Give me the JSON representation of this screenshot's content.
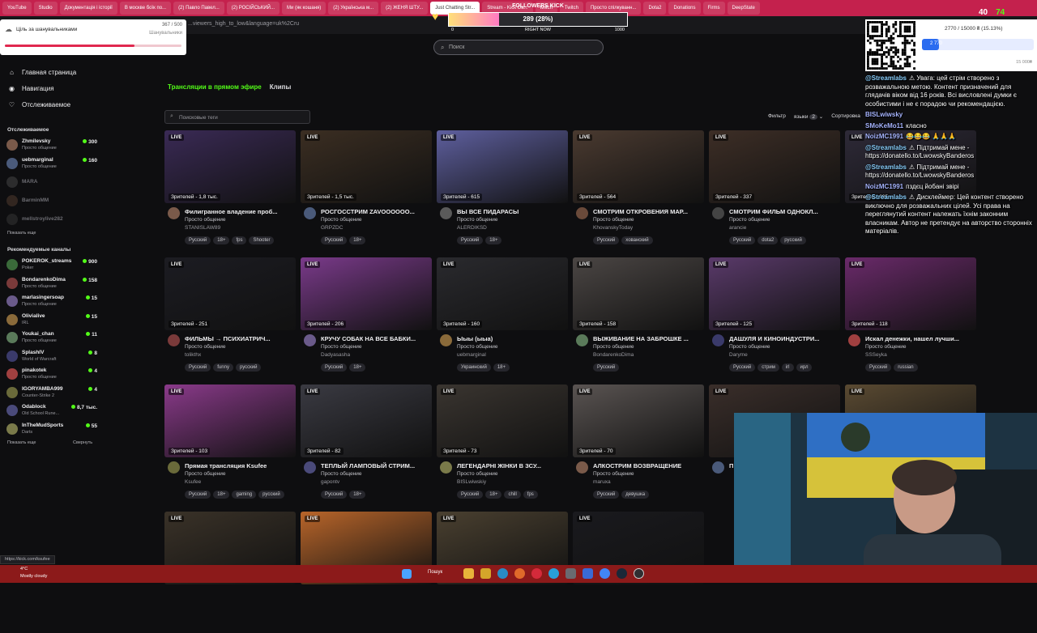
{
  "browser": {
    "tabs": [
      "YouTube",
      "Studio",
      "Документація і історії",
      "В москве боїк по...",
      "(2) Павло Павел...",
      "(2) РОСІЙСЬКИЙ...",
      "Ми (як кошаня)",
      "(2) Українська м...",
      "(2) ЖЕНЯ ШТУ...",
      "Just Chatting Str...",
      "Stream - Kick Da...",
      "twitch",
      "Twitch",
      "Просто спілкуванн...",
      "Dota2",
      "Donations",
      "Firms",
      "DeepState"
    ],
    "active_tab": 9,
    "url": "...viewers_high_to_low&language=uk%2Cru",
    "status_url": "https://kick.com/ksufee"
  },
  "colors": {
    "brand": "#53fc18",
    "tab_bar": "#c4214d",
    "taskbar": "#8c1a1a"
  },
  "overlays": {
    "goal": {
      "icon": "cloud-icon",
      "title": "Ціль за шанувальниками",
      "count": "367 / 500",
      "sub": "Шанувальники",
      "progress": 0.734
    },
    "followers_goal": {
      "label": "FOLLOWERS KICK",
      "value": "289 (28%)",
      "min": "0",
      "mid": "RIGHT NOW",
      "max": "1000",
      "progress": 0.28
    },
    "donate": {
      "text": "2770 / 15000 ₴ (15.13%)",
      "value": "2 770",
      "max": "15 000₴",
      "progress": 0.1513
    },
    "corner": {
      "a": "40",
      "b": "74"
    }
  },
  "header": {
    "search_placeholder": "Поиск"
  },
  "sidebar": {
    "nav": [
      {
        "icon": "home-icon",
        "label": "Главная страница"
      },
      {
        "icon": "compass-icon",
        "label": "Навигация"
      },
      {
        "icon": "heart-icon",
        "label": "Отслеживаемое"
      }
    ],
    "following_title": "Отслеживаемое",
    "following": [
      {
        "name": "Zhmilevsky",
        "category": "Просто общение",
        "viewers": "300",
        "online": true
      },
      {
        "name": "uebmarginal",
        "category": "Просто общение",
        "viewers": "160",
        "online": true
      },
      {
        "name": "MARA",
        "category": "",
        "viewers": "",
        "online": false
      },
      {
        "name": "BarminMM",
        "category": "",
        "viewers": "",
        "online": false
      },
      {
        "name": "mellstroylive282",
        "category": "",
        "viewers": "",
        "online": false
      }
    ],
    "show_more": "Показать еще",
    "recommended_title": "Рекомендуемые каналы",
    "recommended": [
      {
        "name": "POKEROK_streams",
        "category": "Poker",
        "viewers": "900"
      },
      {
        "name": "BondarenkoDima",
        "category": "Просто общение",
        "viewers": "158"
      },
      {
        "name": "marlasingersoap",
        "category": "Просто общение",
        "viewers": "15"
      },
      {
        "name": "Olivialive",
        "category": "IRL",
        "viewers": "15"
      },
      {
        "name": "Youkai_chan",
        "category": "Просто общение",
        "viewers": "11"
      },
      {
        "name": "SplashIV",
        "category": "World of Warcraft",
        "viewers": "8"
      },
      {
        "name": "pinakotek",
        "category": "Просто общение",
        "viewers": "4"
      },
      {
        "name": "IGORYAMBA999",
        "category": "Counter-Strike 2",
        "viewers": "4"
      },
      {
        "name": "Odablock",
        "category": "Old School Rune...",
        "viewers": "8,7 тыс."
      },
      {
        "name": "InTheMudSports",
        "category": "Darts",
        "viewers": "55"
      }
    ],
    "show_more2": "Показать еще",
    "collapse": "Свернуть"
  },
  "main": {
    "tabs": [
      "Трансляции в прямом эфире",
      "Клипы"
    ],
    "tag_placeholder": "Поисковые теги",
    "filter": {
      "label": "Фильтр",
      "languages": "языки",
      "lang_count": "2",
      "sort": "Сортировка"
    },
    "live_label": "LIVE",
    "streams": [
      {
        "viewers": "Зрителей - 1,8 тыс.",
        "title": "Филигранное владение проб...",
        "category": "Просто общение",
        "channel": "STANISLAW89",
        "tags": [
          "Русский",
          "18+",
          "fps",
          "Shooter"
        ],
        "color": "#3a2a55"
      },
      {
        "viewers": "Зрителей - 1,5 тыс.",
        "title": "РОСГОССТРИМ ZAVOOOOOO...",
        "category": "Просто общение",
        "channel": "GRPZDC",
        "tags": [
          "Русский",
          "18+"
        ],
        "color": "#3b2e22"
      },
      {
        "viewers": "Зрителей - 615",
        "title": "ВЫ ВСЕ ПИДАРАСЫ",
        "category": "Просто общение",
        "channel": "ALERDIKSD",
        "tags": [
          "Русский",
          "18+"
        ],
        "color": "#5e5f9e"
      },
      {
        "viewers": "Зрителей - 564",
        "title": "СМОТРИМ ОТКРОВЕНИЯ МАР...",
        "category": "Просто общение",
        "channel": "KhovanskyToday",
        "tags": [
          "Русский",
          "хованский"
        ],
        "color": "#4a3a30"
      },
      {
        "viewers": "Зрителей - 337",
        "title": "СМОТРИМ ФИЛЬМ ОДНОКЛ...",
        "category": "Просто общение",
        "channel": "arancie",
        "tags": [
          "Русский",
          "dota2",
          "русский"
        ],
        "color": "#3d2e26"
      },
      {
        "viewers": "Зрителей - 295",
        "title": "",
        "category": "",
        "channel": "",
        "tags": [],
        "color": "#2e2a38"
      },
      {
        "viewers": "Зрителей - 251",
        "title": "ФИЛЬМЫ → ПСИХИАТРИЧ...",
        "category": "Просто общение",
        "channel": "tolikthx",
        "tags": [
          "Русский",
          "funny",
          "русский"
        ],
        "color": "#1c1c22"
      },
      {
        "viewers": "Зрителей - 206",
        "title": "КРУЧУ СОБАК НА ВСЕ БАБКИ...",
        "category": "Просто общение",
        "channel": "Dadyasasha",
        "tags": [
          "Русский",
          "18+"
        ],
        "color": "#7a3a8a"
      },
      {
        "viewers": "Зрителей - 160",
        "title": "Ыыы (ыыа)",
        "category": "Просто общение",
        "channel": "uebmarginal",
        "tags": [
          "Украинский",
          "18+"
        ],
        "color": "#2a2a2e"
      },
      {
        "viewers": "Зрителей - 158",
        "title": "ВЫЖИВАНИЕ НА ЗАБРОШКЕ ...",
        "category": "Просто общение",
        "channel": "BondarenkoDima",
        "tags": [
          "Русский"
        ],
        "color": "#4b4644"
      },
      {
        "viewers": "Зрителей - 125",
        "title": "ДАШУЛЯ И КИНОИНДУСТРИ...",
        "category": "Просто общение",
        "channel": "Daryme",
        "tags": [
          "Русский",
          "стрим",
          "irl",
          "ирл"
        ],
        "color": "#5a3a6a"
      },
      {
        "viewers": "Зрителей - 118",
        "title": "Искал денежки, нашел лучши...",
        "category": "Просто общение",
        "channel": "SSSeyka",
        "tags": [
          "Русский",
          "russian"
        ],
        "color": "#6a2a6a"
      },
      {
        "viewers": "Зрителей - 103",
        "title": "Прямая трансляция Ksufee",
        "category": "Просто общение",
        "channel": "Ksufee",
        "tags": [
          "Русский",
          "18+",
          "gaming",
          "русский"
        ],
        "color": "#8a3a8a"
      },
      {
        "viewers": "Зрителей - 82",
        "title": "ТЕПЛЫЙ ЛАМПОВЫЙ СТРИМ...",
        "category": "Просто общение",
        "channel": "gapontv",
        "tags": [
          "Русский",
          "18+"
        ],
        "color": "#3a3a42"
      },
      {
        "viewers": "Зрителей - 73",
        "title": "ЛЕГЕНДАРНІ ЖІНКИ В ЗСУ...",
        "category": "Просто общение",
        "channel": "BISLwiwskiy",
        "tags": [
          "Русский",
          "18+",
          "chill",
          "fps"
        ],
        "color": "#3a3530"
      },
      {
        "viewers": "Зрителей - 70",
        "title": "АЛКОСТРИМ ВОЗВРАЩЕНИЕ",
        "category": "Просто общение",
        "channel": "maruxa",
        "tags": [
          "Русский",
          "девушка"
        ],
        "color": "#5a5452"
      },
      {
        "viewers": "",
        "title": "П",
        "category": "",
        "channel": "",
        "tags": [],
        "color": "#3a2e2a"
      },
      {
        "viewers": "",
        "title": "",
        "category": "",
        "channel": "",
        "tags": [],
        "color": "#5a4a32"
      },
      {
        "viewers": "",
        "title": "",
        "category": "",
        "channel": "",
        "tags": [],
        "color": "#3a3228"
      },
      {
        "viewers": "",
        "title": "",
        "category": "",
        "channel": "",
        "tags": [],
        "color": "#b8652a"
      },
      {
        "viewers": "",
        "title": "",
        "category": "",
        "channel": "",
        "tags": [],
        "color": "#4a4030"
      },
      {
        "viewers": "",
        "title": "",
        "category": "",
        "channel": "",
        "tags": [],
        "color": "#1a1a1e"
      }
    ]
  },
  "chat": [
    {
      "user": "@Streamlabs",
      "text": "⚠ Увага: цей стрім створено з розважальною метою. Контент призначений для глядачів віком від 16 років. Всі висловлені думки є особистими і не є порадою чи рекомендацією."
    },
    {
      "user": "BISLwiwsky",
      "text": ""
    },
    {
      "user": "SMoKeMo11",
      "text": "класно"
    },
    {
      "user": "NoizMC1991",
      "text": "😂😂😂 🙏🙏🙏"
    },
    {
      "user": "@Streamlabs",
      "text": "⚠ Підтримай мене - https://donatello.to/LwowskyBanderos"
    },
    {
      "user": "@Streamlabs",
      "text": "⚠ Підтримай мене - https://donatello.to/LwowskyBanderos"
    },
    {
      "user": "NoizMC1991",
      "text": "пздєц йобані звірі"
    },
    {
      "user": "@Streamlabs",
      "text": "⚠ Дисклеймер: Цей контент створено виключно для розважальних цілей. Усі права на переглянутий контент належать їхнім законним власникам. Автор не претендує на авторство сторонніх матеріалів."
    }
  ],
  "taskbar": {
    "temp": "4°C",
    "weather": "Mostly cloudy",
    "search": "Пошук"
  }
}
